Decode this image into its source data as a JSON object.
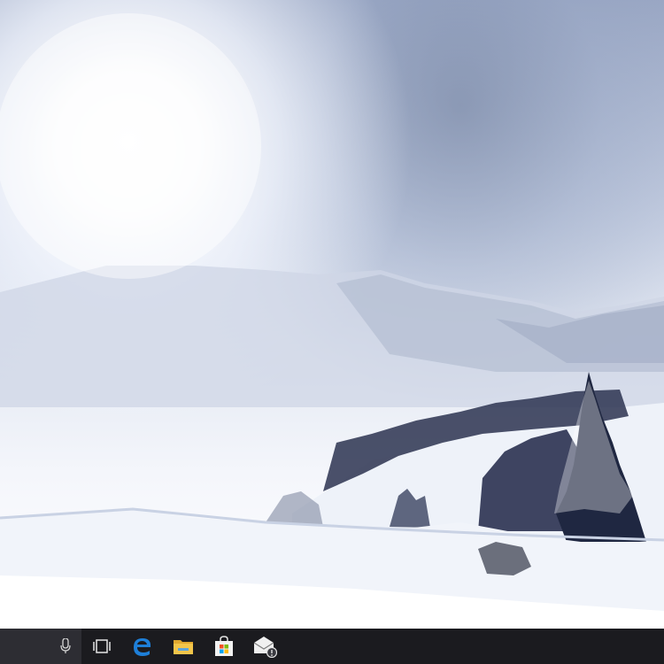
{
  "desktop": {
    "wallpaper": "snowy-mountain-landscape"
  },
  "taskbar": {
    "background": "#1b1b1f",
    "items": [
      {
        "name": "microphone-icon",
        "app": "cortana-voice"
      },
      {
        "name": "task-view-icon",
        "app": "task-view"
      },
      {
        "name": "edge-browser-icon",
        "app": "microsoft-edge"
      },
      {
        "name": "file-explorer-icon",
        "app": "file-explorer"
      },
      {
        "name": "store-icon",
        "app": "microsoft-store"
      },
      {
        "name": "mail-icon",
        "app": "mail"
      }
    ],
    "colors": {
      "edge": "#1e7fd8",
      "folder": "#f2c54a",
      "store_red": "#f25022",
      "store_green": "#7fba00",
      "store_blue": "#00a4ef",
      "store_yellow": "#ffb900"
    }
  }
}
